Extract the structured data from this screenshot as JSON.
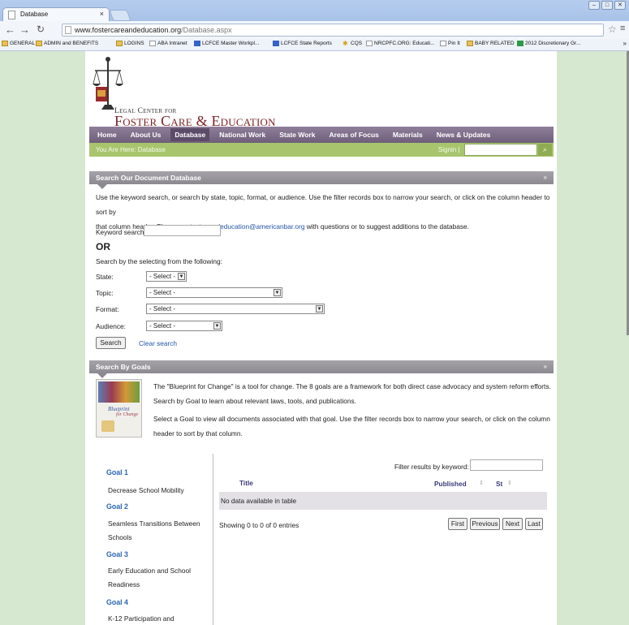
{
  "browser": {
    "tab_title": "Database",
    "tab_close": "×",
    "url_host": "www.fostercareandeducation.org",
    "url_path": "/Database.aspx",
    "bookmarks": [
      {
        "label": "GENERAL",
        "icon": "folder"
      },
      {
        "label": "ADMIN and BENEFITS",
        "icon": "folder"
      },
      {
        "label": "LOGINS",
        "icon": "folder"
      },
      {
        "label": "ABA Intranet",
        "icon": "page"
      },
      {
        "label": "LCFCE Master Workpl...",
        "icon": "blue"
      },
      {
        "label": "LCFCE State Reports",
        "icon": "blue"
      },
      {
        "label": "CQS",
        "icon": "cq"
      },
      {
        "label": "NRCPFC.ORG: Educati...",
        "icon": "page"
      },
      {
        "label": "Pin It",
        "icon": "page"
      },
      {
        "label": "BABY RELATED",
        "icon": "folder"
      },
      {
        "label": "2012 Discretionary Gr...",
        "icon": "green"
      }
    ],
    "bookmarks_more": "»"
  },
  "site": {
    "logo_legal": "Legal Center for",
    "logo_main": "Foster Care & Education",
    "nav": [
      "Home",
      "About Us",
      "Database",
      "National Work",
      "State Work",
      "Areas of Focus",
      "Materials",
      "News & Updates"
    ],
    "nav_active": "Database",
    "breadcrumb": "You Are Here: Database",
    "signin": "Signin |",
    "search_icon": "search-icon"
  },
  "search_section": {
    "title": "Search Our Document Database",
    "intro_line1": "Use the keyword search, or search by state, topic, format, or audience. Use the filter records box to narrow your search, or click on the column header to sort by",
    "intro_line2_pre": "that column header. Please contact us ",
    "contact_email": "ccleducation@americanbar.org",
    "intro_line2_post": " with questions or to suggest additions to the database.",
    "keyword_label": "Keyword search:",
    "keyword_value": "",
    "or_label": "OR",
    "search_by_label": "Search by the selecting from the following:",
    "state_label": "State:",
    "state_value": "- Select -",
    "topic_label": "Topic:",
    "topic_value": "- Select -",
    "format_label": "Format:",
    "format_value": "- Select -",
    "audience_label": "Audience:",
    "audience_value": "- Select -",
    "search_button": "Search",
    "clear_link": "Clear search"
  },
  "goals_section": {
    "title": "Search By Goals",
    "desc_line1": "The \"Blueprint for Change\" is a tool for change. The 8 goals are a framework for both direct case advocacy and system reform efforts.",
    "desc_line2": "Search by Goal to learn about relevant laws, tools, and publications.",
    "desc_line3": "Select a Goal to view all documents associated with that goal. Use the filter records box to narrow your search, or click on the column",
    "desc_line4": "header to sort by that column.",
    "cover_title": "Blueprint",
    "cover_sub": "for Change",
    "goals": [
      {
        "label": "Goal 1",
        "text": "Decrease School Mobility"
      },
      {
        "label": "Goal 2",
        "text": "Seamless Transitions Between Schools"
      },
      {
        "label": "Goal 3",
        "text": "Early Education and School Readiness"
      },
      {
        "label": "Goal 4",
        "text": "K-12 Participation and"
      }
    ],
    "filter_label": "Filter results by keyword:",
    "filter_value": "",
    "col_title": "Title",
    "col_published": "Published",
    "col_st": "St",
    "empty_text": "No data available in table",
    "showing": "Showing 0 to 0 of 0 entries",
    "pager": [
      "First",
      "Previous",
      "Next",
      "Last"
    ]
  }
}
